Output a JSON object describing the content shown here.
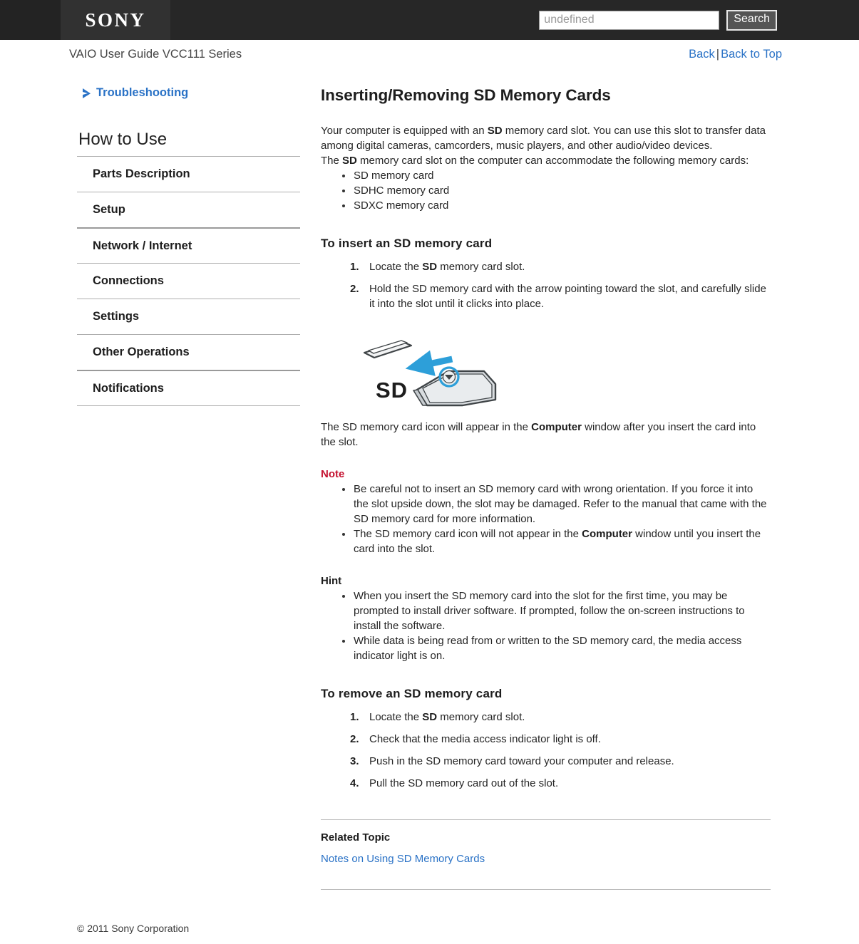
{
  "header": {
    "logo_text": "SONY",
    "search": {
      "placeholder": "undefined",
      "value": "",
      "button_label": "Search"
    }
  },
  "breadcrumb": {
    "title": "VAIO User Guide VCC111 Series",
    "back_label": "Back",
    "separator": "|",
    "back_to_top_label": "Back to Top"
  },
  "sidebar": {
    "troubleshooting_label": "Troubleshooting",
    "troubleshooting_icon": "chevron-right-icon",
    "section_title": "How to Use",
    "items": [
      {
        "label": "Parts Description"
      },
      {
        "label": "Setup"
      },
      {
        "label": "Network / Internet"
      },
      {
        "label": "Connections"
      },
      {
        "label": "Settings"
      },
      {
        "label": "Other Operations"
      },
      {
        "label": "Notifications"
      }
    ]
  },
  "main": {
    "title": "Inserting/Removing SD Memory Cards",
    "intro": {
      "line1_a": "Your computer is equipped with an ",
      "line1_b": "SD",
      "line1_c": " memory card slot. You can use this slot to transfer data among digital cameras, camcorders, music players, and other audio/video devices.",
      "line2_a": "The ",
      "line2_b": "SD",
      "line2_c": " memory card slot on the computer can accommodate the following memory cards:"
    },
    "card_types": [
      "SD memory card",
      "SDHC memory card",
      "SDXC memory card"
    ],
    "insert_section": {
      "heading": "To insert an SD memory card",
      "steps": [
        {
          "pre": "Locate the ",
          "bold": "SD",
          "post": " memory card slot."
        },
        {
          "pre": "Hold the SD memory card with the arrow pointing toward the slot, and carefully slide it into the slot until it clicks into place.",
          "bold": "",
          "post": ""
        }
      ],
      "figure": {
        "name": "sd-card-insertion-illustration",
        "label": "SD",
        "arrow_color": "#2d9fd9",
        "card_fill": "#d9dde0",
        "outline_color": "#3f4447"
      },
      "after_figure_a": "The SD memory card icon will appear in the ",
      "after_figure_b": "Computer",
      "after_figure_c": " window after you insert the card into the slot."
    },
    "note": {
      "heading": "Note",
      "color": "#c41230",
      "items": [
        {
          "pre": "Be careful not to insert an SD memory card with wrong orientation. If you force it into the slot upside down, the slot may be damaged. Refer to the manual that came with the SD memory card for more information.",
          "bold": "",
          "post": ""
        },
        {
          "pre": "The SD memory card icon will not appear in the ",
          "bold": "Computer",
          "post": " window until you insert the card into the slot."
        }
      ]
    },
    "hint": {
      "heading": "Hint",
      "items": [
        "When you insert the SD memory card into the slot for the first time, you may be prompted to install driver software. If prompted, follow the on-screen instructions to install the software.",
        "While data is being read from or written to the SD memory card, the media access indicator light is on."
      ]
    },
    "remove_section": {
      "heading": "To remove an SD memory card",
      "steps": [
        {
          "pre": "Locate the ",
          "bold": "SD",
          "post": " memory card slot."
        },
        {
          "pre": "Check that the media access indicator light is off.",
          "bold": "",
          "post": ""
        },
        {
          "pre": "Push in the SD memory card toward your computer and release.",
          "bold": "",
          "post": ""
        },
        {
          "pre": "Pull the SD memory card out of the slot.",
          "bold": "",
          "post": ""
        }
      ]
    },
    "related": {
      "heading": "Related Topic",
      "links": [
        "Notes on Using SD Memory Cards"
      ]
    }
  },
  "footer": {
    "copyright": "© 2011 Sony Corporation"
  },
  "colors": {
    "link": "#2a72c6",
    "header_bg": "#272727",
    "note_red": "#c41230",
    "accent_blue": "#2d9fd9"
  }
}
